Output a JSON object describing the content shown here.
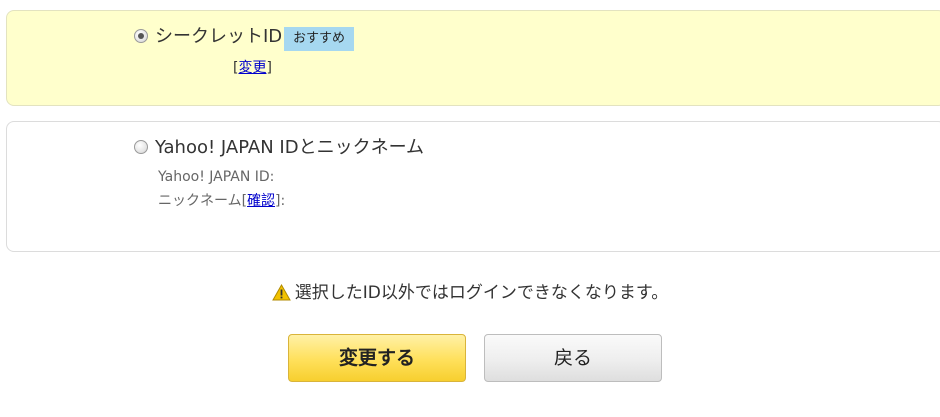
{
  "options": {
    "secret": {
      "label": "シークレットID",
      "badge": "おすすめ",
      "bracket_open": "[",
      "link": "変更",
      "bracket_close": "]",
      "selected": true
    },
    "yahoo": {
      "label": "Yahoo! JAPAN IDとニックネーム",
      "id_line": "Yahoo! JAPAN ID:",
      "nickname_prefix": "ニックネーム[",
      "nickname_link": "確認",
      "nickname_suffix": "]:",
      "selected": false
    }
  },
  "warning": {
    "icon": "warning-icon",
    "text": "選択したID以外ではログインできなくなります。"
  },
  "buttons": {
    "submit": "変更する",
    "back": "戻る"
  },
  "colors": {
    "selected_bg": "#ffffcc",
    "badge_bg": "#a6d8f0",
    "link": "#0000cc",
    "primary_button": "#ffe05a",
    "warning_icon": "#f2c200"
  }
}
